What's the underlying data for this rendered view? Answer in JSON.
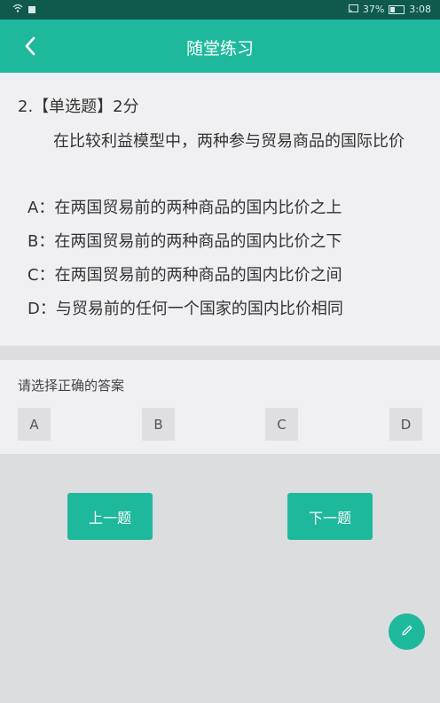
{
  "status_bar": {
    "battery": "37%",
    "time": "3:08",
    "icons": [
      "wifi-icon",
      "sim-icon",
      "cast-icon",
      "battery-icon"
    ]
  },
  "header": {
    "title": "随堂练习",
    "back_icon": "chevron-left-icon"
  },
  "question": {
    "heading": "2.【单选题】2分",
    "stem": "在比较利益模型中，两种参与贸易商品的国际比价",
    "options": [
      {
        "letter": "A：",
        "text": "在两国贸易前的两种商品的国内比价之上"
      },
      {
        "letter": "B：",
        "text": "在两国贸易前的两种商品的国内比价之下"
      },
      {
        "letter": "C：",
        "text": "在两国贸易前的两种商品的国内比价之间"
      },
      {
        "letter": "D：",
        "text": "与贸易前的任何一个国家的国内比价相同"
      }
    ]
  },
  "answer": {
    "prompt": "请选择正确的答案",
    "choices": [
      "A",
      "B",
      "C",
      "D"
    ]
  },
  "nav": {
    "prev_label": "上一题",
    "next_label": "下一题"
  },
  "fab": {
    "icon": "pencil-icon"
  },
  "colors": {
    "accent": "#1eb99d",
    "status_bar": "#0f5a4c",
    "card_bg": "#f0eff1",
    "page_bg": "#dcdddf"
  }
}
